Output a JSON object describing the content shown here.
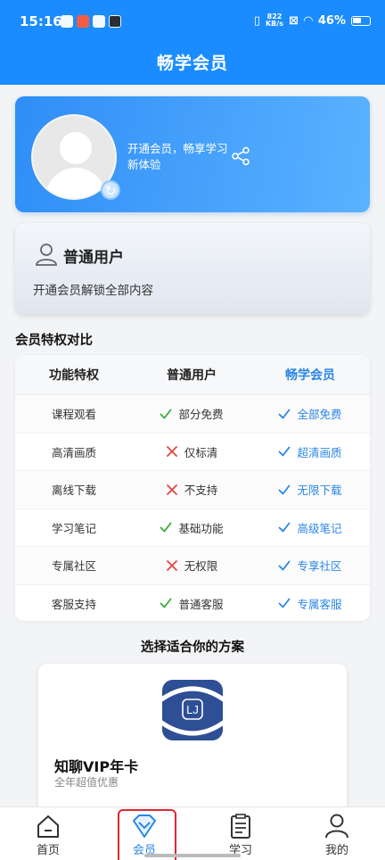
{
  "status": {
    "time": "15:16",
    "speed_top": "822",
    "speed_bottom": "KB/s",
    "battery": "46%"
  },
  "header": {
    "title": "畅学会员"
  },
  "profile": {
    "promo": "开通会员，畅享学习新体验"
  },
  "user_card": {
    "title": "普通用户",
    "subtitle": "开通会员解锁全部内容"
  },
  "compare": {
    "section_title": "会员特权对比",
    "headers": [
      "功能特权",
      "普通用户",
      "畅学会员"
    ],
    "rows": [
      {
        "feature": "课程观看",
        "normal": "部分免费",
        "normal_ok": true,
        "vip": "全部免费"
      },
      {
        "feature": "高清画质",
        "normal": "仅标清",
        "normal_ok": false,
        "vip": "超清画质"
      },
      {
        "feature": "离线下载",
        "normal": "不支持",
        "normal_ok": false,
        "vip": "无限下载"
      },
      {
        "feature": "学习笔记",
        "normal": "基础功能",
        "normal_ok": true,
        "vip": "高级笔记"
      },
      {
        "feature": "专属社区",
        "normal": "无权限",
        "normal_ok": false,
        "vip": "专享社区"
      },
      {
        "feature": "客服支持",
        "normal": "普通客服",
        "normal_ok": true,
        "vip": "专属客服"
      }
    ]
  },
  "plans": {
    "section_title": "选择适合你的方案",
    "items": [
      {
        "logo_text": "LJ",
        "name": "知聊VIP年卡",
        "subtitle": "全年超值优惠"
      }
    ]
  },
  "tabbar": {
    "items": [
      {
        "label": "首页",
        "icon": "home-icon",
        "active": false
      },
      {
        "label": "会员",
        "icon": "diamond-icon",
        "active": true
      },
      {
        "label": "学习",
        "icon": "clipboard-icon",
        "active": false
      },
      {
        "label": "我的",
        "icon": "person-icon",
        "active": false
      }
    ]
  },
  "colors": {
    "primary": "#1a8cff",
    "accent_text": "#2b86e6",
    "check_green": "#3aaa35",
    "cross_red": "#e0483e",
    "highlight_border": "#e0262f"
  }
}
